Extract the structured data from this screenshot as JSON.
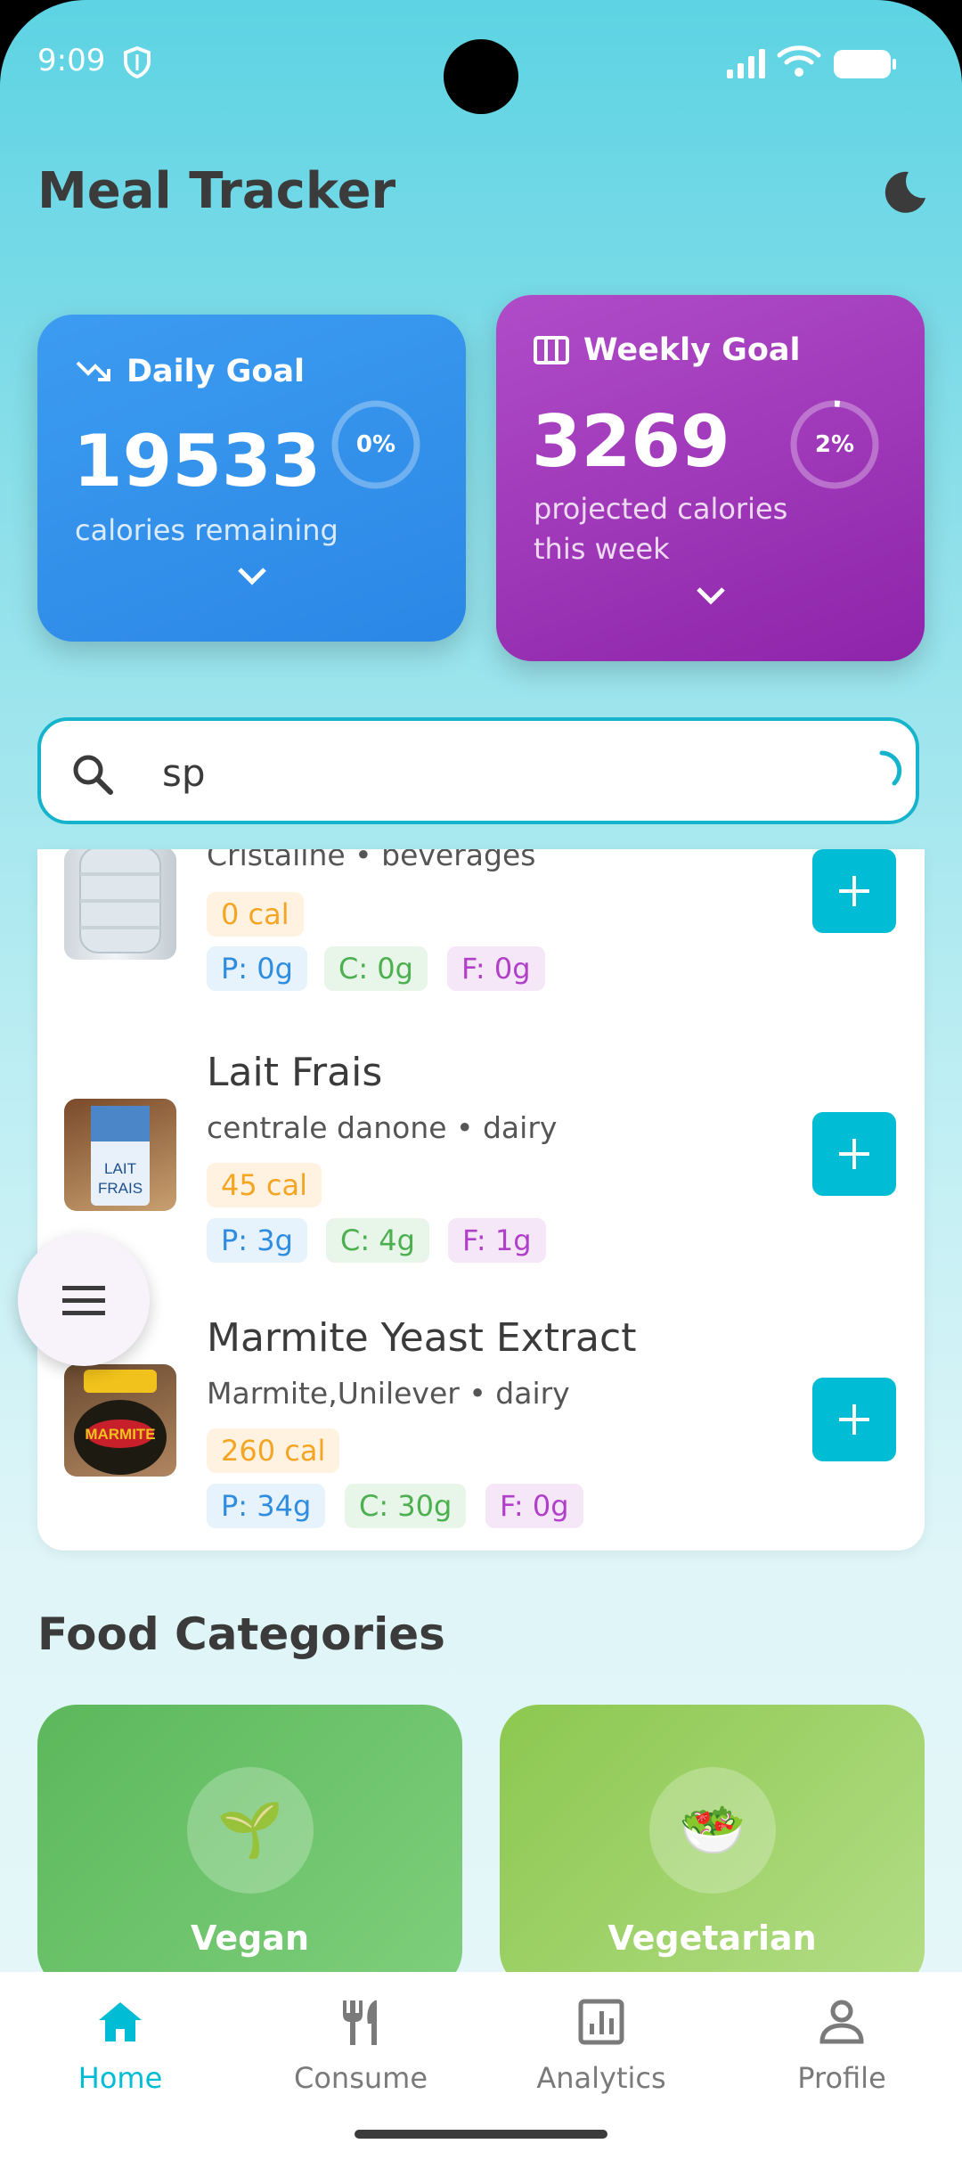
{
  "status_bar": {
    "time": "9:09"
  },
  "app": {
    "title": "Meal Tracker"
  },
  "daily_goal": {
    "title": "Daily Goal",
    "value": "19533",
    "subtitle": "calories remaining",
    "progress_label": "0%",
    "progress": 0
  },
  "weekly_goal": {
    "title": "Weekly Goal",
    "value": "3269",
    "subtitle": "projected calories this week",
    "progress_label": "2%",
    "progress": 0.02
  },
  "search": {
    "value": "sp"
  },
  "results": [
    {
      "name": "",
      "brand": "Cristaline • beverages",
      "calories": "0 cal",
      "protein": "P: 0g",
      "carbs": "C: 0g",
      "fat": "F: 0g"
    },
    {
      "name": "Lait Frais",
      "brand": "centrale danone • dairy",
      "calories": "45 cal",
      "protein": "P: 3g",
      "carbs": "C: 4g",
      "fat": "F: 1g"
    },
    {
      "name": "Marmite Yeast Extract",
      "brand": "Marmite,Unilever • dairy",
      "calories": "260 cal",
      "protein": "P: 34g",
      "carbs": "C: 30g",
      "fat": "F: 0g"
    }
  ],
  "thumb_labels": {
    "milk": "LAIT FRAIS",
    "marmite": "MARMITE"
  },
  "categories_section": {
    "title": "Food Categories"
  },
  "categories": [
    {
      "label": "Vegan",
      "icon": "🌱"
    },
    {
      "label": "Vegetarian",
      "icon": "🥗"
    }
  ],
  "nav": [
    {
      "label": "Home",
      "icon": "home-icon"
    },
    {
      "label": "Consume",
      "icon": "fork-knife-icon"
    },
    {
      "label": "Analytics",
      "icon": "chart-icon"
    },
    {
      "label": "Profile",
      "icon": "person-icon"
    }
  ],
  "colors": {
    "accent": "#00bcd4",
    "daily": "#2b87e6",
    "weekly": "#8e24aa"
  }
}
